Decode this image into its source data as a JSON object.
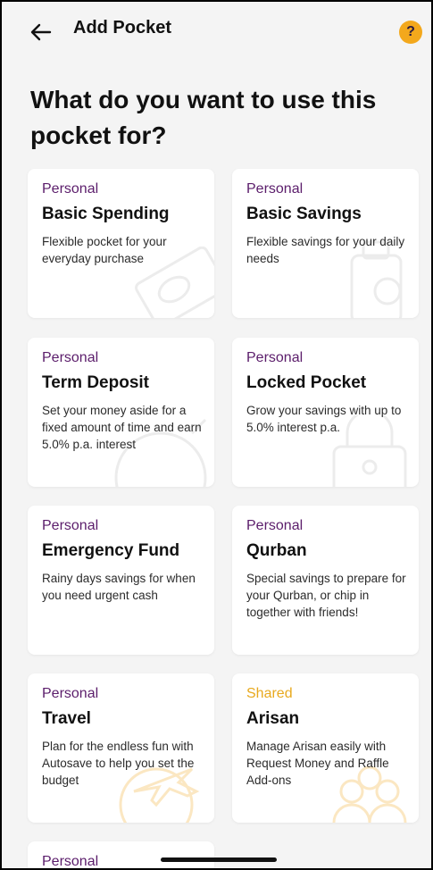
{
  "header": {
    "title": "Add Pocket",
    "help_label": "?"
  },
  "page": {
    "heading": "What do you want to use this pocket for?"
  },
  "colors": {
    "personal": "#5b1d6b",
    "shared": "#e8a91e",
    "help_badge": "#f3a81c"
  },
  "cards": [
    {
      "category": "Personal",
      "name": "Basic Spending",
      "description": "Flexible pocket for your everyday purchase",
      "icon": "money-bill-icon"
    },
    {
      "category": "Personal",
      "name": "Basic Savings",
      "description": "Flexible savings for your daily needs",
      "icon": "suitcase-icon"
    },
    {
      "category": "Personal",
      "name": "Term Deposit",
      "description": "Set your money aside for a fixed amount of time and earn 5.0% p.a. interest",
      "icon": "clock-icon"
    },
    {
      "category": "Personal",
      "name": "Locked Pocket",
      "description": "Grow your savings with up to 5.0% interest p.a.",
      "icon": "lock-icon"
    },
    {
      "category": "Personal",
      "name": "Emergency Fund",
      "description": "Rainy days savings for when you need urgent cash",
      "icon": "umbrella-icon"
    },
    {
      "category": "Personal",
      "name": "Qurban",
      "description": "Special savings to prepare for your Qurban, or chip in together with friends!",
      "icon": "goat-icon"
    },
    {
      "category": "Personal",
      "name": "Travel",
      "description": "Plan for the endless fun with Autosave to help you set the budget",
      "icon": "airplane-icon"
    },
    {
      "category": "Shared",
      "name": "Arisan",
      "description": "Manage Arisan easily with Request Money and Raffle Add-ons",
      "icon": "group-icon"
    },
    {
      "category": "Personal",
      "name": "",
      "description": "",
      "icon": ""
    }
  ]
}
